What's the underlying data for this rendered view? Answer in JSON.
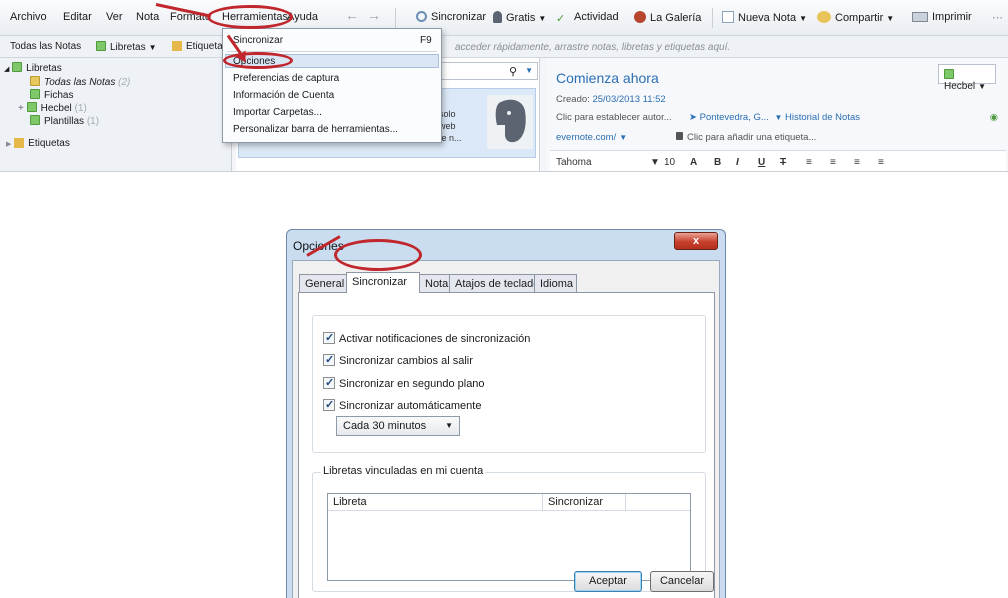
{
  "app": {
    "menu": [
      "Archivo",
      "Editar",
      "Ver",
      "Nota",
      "Formato",
      "Herramientas",
      "Ayuda"
    ],
    "toolbar": {
      "sync": "Sincronizar",
      "account": "Gratis",
      "activity": "Actividad",
      "gallery": "La Galería",
      "new_note": "Nueva Nota",
      "share": "Compartir",
      "print": "Imprimir"
    },
    "toolbar2": {
      "all_notes": "Todas las Notas",
      "notebooks": "Libretas",
      "tags": "Etiqueta",
      "hint": "acceder rápidamente, arrastre notas, libretas y etiquetas aquí."
    },
    "sidebar": {
      "notebooks_root": "Libretas",
      "all_notes": "Todas las Notas",
      "all_notes_count": "(2)",
      "items": [
        {
          "label": "Fichas",
          "count": ""
        },
        {
          "label": "Hecbel",
          "count": "(1)"
        },
        {
          "label": "Plantillas",
          "count": "(1)"
        }
      ],
      "tags_root": "Etiquetas"
    },
    "note_list": {
      "card_lines": [
        "solo",
        "web",
        "te n..."
      ]
    },
    "editor": {
      "title": "Comienza ahora",
      "notebook": "Hecbel",
      "created_label": "Creado:",
      "created_value": "25/03/2013 11:52",
      "author_hint": "Clic para establecer autor...",
      "location": "Pontevedra, G...",
      "history": "Historial de Notas",
      "url": "evernote.com/",
      "tag_hint": "Clic para añadir una etiqueta...",
      "font": "Tahoma",
      "font_size": "10"
    },
    "dropdown": {
      "items": [
        "Sincronizar",
        "Opciones",
        "Preferencias de captura",
        "Información de Cuenta",
        "Importar Carpetas...",
        "Personalizar barra de herramientas..."
      ],
      "shortcut": "F9"
    }
  },
  "dialog": {
    "title": "Opciones",
    "close": "x",
    "tabs": [
      "General",
      "Sincronizar",
      "Nota",
      "Atajos de teclado",
      "Idioma"
    ],
    "active_tab": "Sincronizar",
    "options": [
      {
        "label": "Activar notificaciones de sincronización",
        "checked": true
      },
      {
        "label": "Sincronizar cambios al salir",
        "checked": true
      },
      {
        "label": "Sincronizar en segundo plano",
        "checked": true
      },
      {
        "label": "Sincronizar automáticamente",
        "checked": true
      }
    ],
    "interval": "Cada 30 minutos",
    "linked_group_label": "Libretas vinculadas en mi cuenta",
    "columns": [
      "Libreta",
      "Sincronizar"
    ],
    "ok": "Aceptar",
    "cancel": "Cancelar"
  },
  "colors": {
    "annotation": "#c0262b",
    "accent_blue": "#2c6fb3",
    "dialog_frame": "#c9dcf0"
  }
}
